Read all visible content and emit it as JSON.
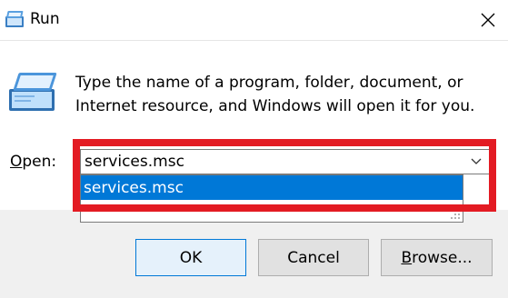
{
  "window": {
    "title": "Run",
    "close_glyph": "✕",
    "icon": "run-app-icon"
  },
  "content": {
    "description_line1": "Type the name of a program, folder, document, or",
    "description_line2": "Internet resource, and Windows will open it for you."
  },
  "open_field": {
    "label_accel": "O",
    "label_rest": "pen:",
    "value": "services.msc",
    "dropdown_arrow": "chevron-down-icon",
    "suggestions": [
      "services.msc"
    ]
  },
  "buttons": {
    "ok": "OK",
    "cancel": "Cancel",
    "browse_accel": "B",
    "browse_rest": "rowse..."
  },
  "colors": {
    "highlight": "#e31b23",
    "selection": "#0078d7",
    "footer": "#f0f0f0"
  }
}
